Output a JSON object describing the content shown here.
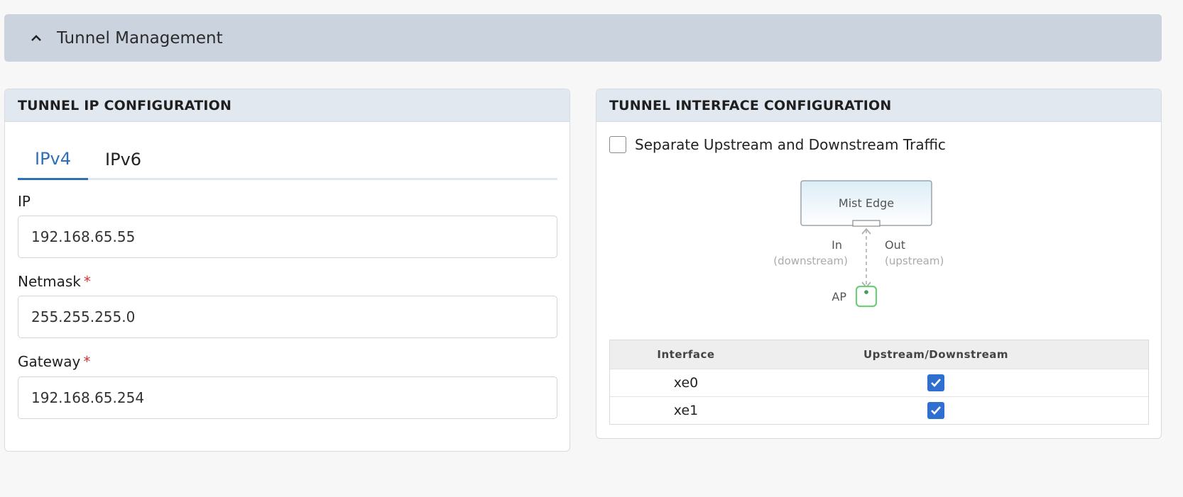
{
  "section": {
    "title": "Tunnel Management"
  },
  "ip_config": {
    "title": "TUNNEL IP CONFIGURATION",
    "tabs": [
      {
        "label": "IPv4",
        "active": true
      },
      {
        "label": "IPv6",
        "active": false
      }
    ],
    "fields": {
      "ip": {
        "label": "IP",
        "value": "192.168.65.55",
        "required": false
      },
      "netmask": {
        "label": "Netmask",
        "value": "255.255.255.0",
        "required": true
      },
      "gateway": {
        "label": "Gateway",
        "value": "192.168.65.254",
        "required": true
      }
    },
    "required_marker": "*"
  },
  "iface_config": {
    "title": "TUNNEL INTERFACE CONFIGURATION",
    "separate_traffic": {
      "label": "Separate Upstream and Downstream Traffic",
      "checked": false
    },
    "diagram": {
      "box_label": "Mist Edge",
      "in_label": "In",
      "in_sub": "(downstream)",
      "out_label": "Out",
      "out_sub": "(upstream)",
      "ap_label": "AP"
    },
    "table": {
      "headers": [
        "Interface",
        "Upstream/Downstream"
      ],
      "rows": [
        {
          "interface": "xe0",
          "checked": true
        },
        {
          "interface": "xe1",
          "checked": true
        }
      ]
    }
  },
  "colors": {
    "accent": "#2f6fb6",
    "header_bg": "#cbd3df",
    "card_header_bg": "#e2e8f0",
    "required": "#d0343a"
  },
  "icons": {
    "collapse": "chevron-up-icon",
    "check": "checkmark-icon"
  }
}
